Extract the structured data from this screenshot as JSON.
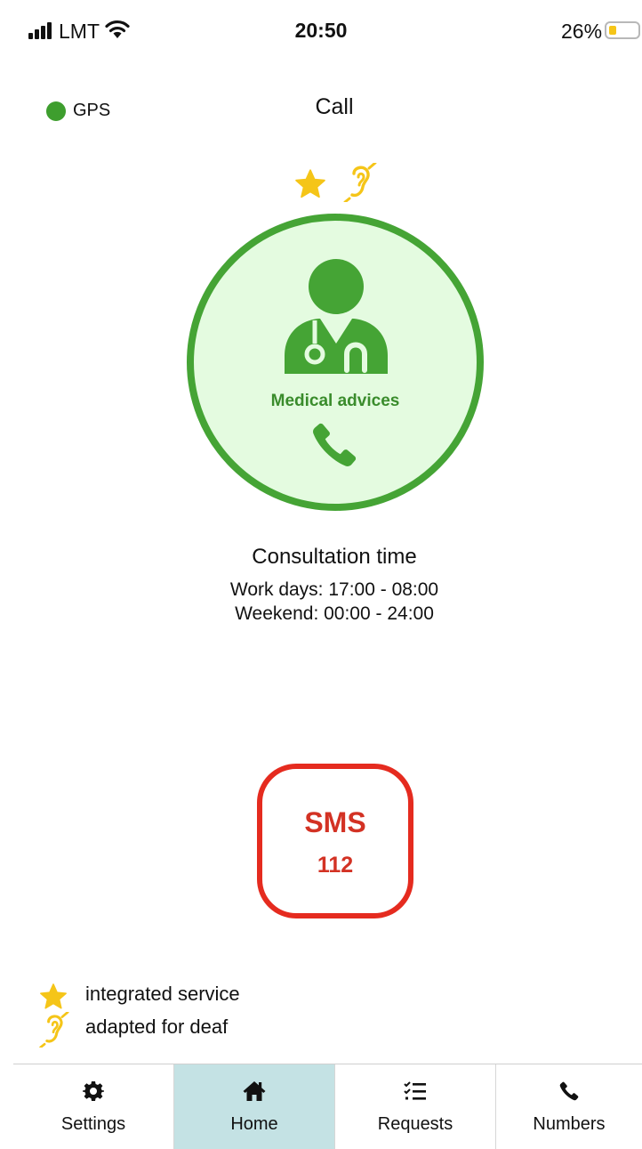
{
  "status_bar": {
    "carrier": "LMT",
    "time": "20:50",
    "battery_percent_text": "26%",
    "battery_level": 0.26
  },
  "header": {
    "gps_label": "GPS",
    "gps_color": "#3e9e2e",
    "title": "Call"
  },
  "service": {
    "badges": [
      "star-icon",
      "ear-icon"
    ],
    "name": "Medical advices",
    "icon": "doctor-icon",
    "call_icon": "phone-icon",
    "accent_color": "#45a435",
    "background_color": "#e4fbe0"
  },
  "consultation": {
    "title": "Consultation time",
    "work_days": "Work days: 17:00 - 08:00",
    "weekend": "Weekend: 00:00 - 24:00"
  },
  "sms_button": {
    "label": "SMS",
    "number": "112",
    "color": "#e52b1f"
  },
  "legend": {
    "items": [
      {
        "icon": "star-icon",
        "label": "integrated service"
      },
      {
        "icon": "ear-icon",
        "label": "adapted for deaf"
      }
    ],
    "icon_color": "#f5c518"
  },
  "tab_bar": {
    "active": "Home",
    "tabs": [
      {
        "icon": "gear-icon",
        "label": "Settings"
      },
      {
        "icon": "home-icon",
        "label": "Home"
      },
      {
        "icon": "checklist-icon",
        "label": "Requests"
      },
      {
        "icon": "phone-icon",
        "label": "Numbers"
      }
    ],
    "active_color": "#c4e2e4"
  }
}
